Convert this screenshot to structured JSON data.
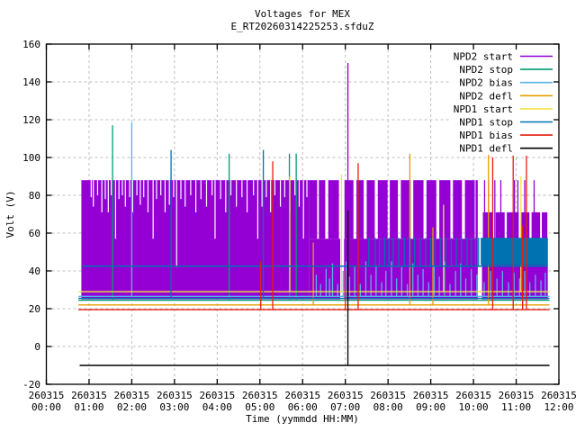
{
  "title": "Voltages for MEX",
  "subtitle": "E_RT20260314225253.sfduZ",
  "axes": {
    "x_label": "Time (yymmdd HH:MM)",
    "y_label": "Volt (V)",
    "x_range_hours": [
      0,
      12
    ],
    "y_range": [
      -20,
      160
    ],
    "x_tick_date": "260315",
    "x_tick_times": [
      "00:00",
      "01:00",
      "02:00",
      "03:00",
      "04:00",
      "05:00",
      "06:00",
      "07:00",
      "08:00",
      "09:00",
      "10:00",
      "11:00",
      "12:00"
    ],
    "y_ticks": [
      -20,
      0,
      20,
      40,
      60,
      80,
      100,
      120,
      140,
      160
    ],
    "grid": true,
    "grid_color": "#bebebe"
  },
  "legend": {
    "position": "top-right",
    "entries": [
      {
        "label": "NPD2 start",
        "color": "#9400D3"
      },
      {
        "label": "NPD2 stop",
        "color": "#009E73"
      },
      {
        "label": "NPD2 bias",
        "color": "#56B4E9"
      },
      {
        "label": "NPD2 defl",
        "color": "#E69F00"
      },
      {
        "label": "NPD1 start",
        "color": "#F0E442"
      },
      {
        "label": "NPD1 stop",
        "color": "#0072B2"
      },
      {
        "label": "NPD1 bias",
        "color": "#E51E10"
      },
      {
        "label": "NPD1 defl",
        "color": "#000000"
      }
    ]
  },
  "chart_data": {
    "type": "line",
    "x_unit": "hours after 260315 00:00",
    "y_unit": "V",
    "data_window_hours": [
      0.75,
      11.78
    ],
    "series": [
      {
        "name": "NPD2 start",
        "color": "#9400D3",
        "elements": [
          {
            "type": "block",
            "t0": 0.82,
            "t1": 6.15,
            "v0": 25,
            "v1": 88
          },
          {
            "type": "notches",
            "color": "#ffffff",
            "v1": 88,
            "items": [
              [
                1.05,
                79
              ],
              [
                1.1,
                74
              ],
              [
                1.2,
                80
              ],
              [
                1.3,
                71
              ],
              [
                1.38,
                78
              ],
              [
                1.45,
                71
              ],
              [
                1.52,
                80
              ],
              [
                1.62,
                57
              ],
              [
                1.7,
                78
              ],
              [
                1.78,
                80
              ],
              [
                1.85,
                74
              ],
              [
                1.95,
                79
              ],
              [
                2.02,
                71
              ],
              [
                2.12,
                80
              ],
              [
                2.2,
                75
              ],
              [
                2.28,
                79
              ],
              [
                2.38,
                71
              ],
              [
                2.5,
                57
              ],
              [
                2.58,
                78
              ],
              [
                2.68,
                80
              ],
              [
                2.78,
                71
              ],
              [
                2.88,
                75
              ],
              [
                2.98,
                79
              ],
              [
                3.05,
                42
              ],
              [
                3.15,
                78
              ],
              [
                3.25,
                74
              ],
              [
                3.38,
                80
              ],
              [
                3.5,
                71
              ],
              [
                3.62,
                78
              ],
              [
                3.75,
                74
              ],
              [
                3.88,
                80
              ],
              [
                3.95,
                57
              ],
              [
                4.08,
                78
              ],
              [
                4.2,
                71
              ],
              [
                4.32,
                80
              ],
              [
                4.45,
                74
              ],
              [
                4.58,
                79
              ],
              [
                4.7,
                71
              ],
              [
                4.85,
                80
              ],
              [
                4.95,
                57
              ],
              [
                5.05,
                74
              ],
              [
                5.15,
                79
              ],
              [
                5.25,
                71
              ],
              [
                5.35,
                80
              ],
              [
                5.48,
                74
              ],
              [
                5.58,
                79
              ],
              [
                5.7,
                71
              ],
              [
                5.82,
                80
              ],
              [
                5.92,
                74
              ],
              [
                6.02,
                57
              ],
              [
                6.1,
                79
              ]
            ]
          },
          {
            "type": "block",
            "t0": 6.15,
            "t1": 11.74,
            "v0": 25,
            "v1": 57
          },
          {
            "type": "columns",
            "v0": 57,
            "items": [
              [
                6.15,
                6.34,
                88
              ],
              [
                6.38,
                6.53,
                88
              ],
              [
                6.6,
                6.85,
                88
              ],
              [
                6.98,
                7.19,
                88
              ],
              [
                7.26,
                7.43,
                88
              ],
              [
                7.5,
                7.69,
                88
              ],
              [
                7.76,
                7.99,
                88
              ],
              [
                8.04,
                8.23,
                88
              ],
              [
                8.3,
                8.53,
                88
              ],
              [
                8.59,
                8.83,
                88
              ],
              [
                8.9,
                9.13,
                88
              ],
              [
                9.2,
                9.46,
                88
              ],
              [
                9.52,
                9.73,
                88
              ],
              [
                9.8,
                10.03,
                88
              ],
              [
                10.05,
                10.1,
                88
              ],
              [
                10.22,
                10.46,
                71
              ],
              [
                10.52,
                10.73,
                71
              ],
              [
                10.78,
                11.06,
                71
              ],
              [
                11.1,
                11.31,
                71
              ],
              [
                11.36,
                11.56,
                71
              ],
              [
                11.6,
                11.73,
                71
              ]
            ]
          },
          {
            "type": "vlines",
            "v0": 57,
            "v1": 88,
            "items": [
              10.26,
              10.35,
              10.5,
              10.64,
              10.96,
              11.04,
              11.2,
              11.42
            ]
          },
          {
            "type": "block",
            "color": "#ffffff",
            "t0": 6.88,
            "t1": 6.97,
            "v0": 25,
            "v1": 88
          },
          {
            "type": "block",
            "color": "#ffffff",
            "t0": 10.1,
            "t1": 10.2,
            "v0": 25,
            "v1": 57
          },
          {
            "type": "spikes",
            "v0": 25,
            "items": [
              [
                7.06,
                150
              ]
            ]
          }
        ]
      },
      {
        "name": "NPD2 stop",
        "color": "#009E73",
        "elements": [
          {
            "type": "hline",
            "v": 24.5,
            "t0": 0.75,
            "t1": 11.78
          },
          {
            "type": "spikes",
            "v0": 24.5,
            "items": [
              [
                1.55,
                117
              ],
              [
                4.28,
                102
              ],
              [
                5.69,
                102
              ],
              [
                5.85,
                102
              ]
            ]
          }
        ]
      },
      {
        "name": "NPD2 bias",
        "color": "#56B4E9",
        "elements": [
          {
            "type": "hline",
            "v": 26.5,
            "t0": 0.75,
            "t1": 11.78
          },
          {
            "type": "spikes",
            "v0": 26.5,
            "items": [
              [
                2.0,
                118.5
              ],
              [
                6.32,
                38
              ],
              [
                6.42,
                33
              ],
              [
                6.55,
                41
              ],
              [
                6.63,
                36
              ],
              [
                6.7,
                44
              ],
              [
                6.82,
                33
              ],
              [
                6.95,
                40
              ],
              [
                7.02,
                45
              ],
              [
                7.1,
                37
              ],
              [
                7.22,
                42
              ],
              [
                7.35,
                33
              ],
              [
                7.48,
                45
              ],
              [
                7.6,
                38
              ],
              [
                7.72,
                43
              ],
              [
                7.85,
                34
              ],
              [
                7.95,
                40
              ],
              [
                8.08,
                45
              ],
              [
                8.2,
                36
              ],
              [
                8.32,
                42
              ],
              [
                8.45,
                33
              ],
              [
                8.58,
                44
              ],
              [
                8.7,
                38
              ],
              [
                8.82,
                41
              ],
              [
                8.95,
                34
              ],
              [
                9.08,
                43
              ],
              [
                9.2,
                37
              ],
              [
                9.32,
                45
              ],
              [
                9.45,
                33
              ],
              [
                9.58,
                40
              ],
              [
                9.7,
                44
              ],
              [
                9.82,
                36
              ],
              [
                9.95,
                41
              ],
              [
                10.08,
                38
              ],
              [
                10.25,
                34
              ],
              [
                10.4,
                40
              ],
              [
                10.55,
                36
              ],
              [
                10.68,
                40
              ],
              [
                10.82,
                34
              ],
              [
                10.95,
                39
              ],
              [
                11.08,
                36
              ],
              [
                11.2,
                40
              ],
              [
                11.32,
                34
              ],
              [
                11.45,
                38
              ],
              [
                11.58,
                35
              ],
              [
                11.68,
                39
              ]
            ]
          }
        ]
      },
      {
        "name": "NPD2 defl",
        "color": "#E69F00",
        "elements": [
          {
            "type": "hline",
            "v": 22,
            "t0": 0.75,
            "t1": 11.78
          },
          {
            "type": "spikes",
            "v0": 22,
            "items": [
              [
                6.25,
                55
              ],
              [
                8.51,
                102
              ],
              [
                9.05,
                63
              ],
              [
                10.35,
                102
              ]
            ]
          }
        ]
      },
      {
        "name": "NPD1 start",
        "color": "#F0E442",
        "elements": [
          {
            "type": "hline",
            "v": 29,
            "t0": 0.75,
            "t1": 11.78
          },
          {
            "type": "spikes",
            "v0": 29,
            "items": [
              [
                5.7,
                90
              ],
              [
                6.91,
                91
              ],
              [
                9.3,
                75
              ],
              [
                11.11,
                90
              ]
            ]
          }
        ]
      },
      {
        "name": "NPD1 stop",
        "color": "#0072B2",
        "elements": [
          {
            "type": "hline",
            "v": 25.5,
            "t0": 0.75,
            "t1": 11.78
          },
          {
            "type": "hline",
            "v": 42.5,
            "t0": 0.82,
            "t1": 11.74
          },
          {
            "type": "vlines",
            "v0": 42,
            "v1": 57.5,
            "items": [
              7.55,
              7.7,
              7.8,
              7.92,
              8.02,
              8.12,
              8.25,
              8.38,
              8.5,
              8.62,
              8.75,
              8.88,
              9.0,
              9.1,
              9.22,
              9.35,
              9.48,
              9.6,
              9.72,
              9.85,
              9.95,
              10.05,
              10.12
            ]
          },
          {
            "type": "block",
            "t0": 10.17,
            "t1": 11.74,
            "v0": 43,
            "v1": 57.5
          },
          {
            "type": "spikes",
            "v0": 25.5,
            "items": [
              [
                2.92,
                104
              ],
              [
                5.08,
                104
              ]
            ]
          }
        ]
      },
      {
        "name": "NPD1 bias",
        "color": "#E51E10",
        "elements": [
          {
            "type": "hline",
            "v": 19.5,
            "t0": 0.75,
            "t1": 11.78
          },
          {
            "type": "spikes",
            "v0": 19.5,
            "items": [
              [
                5.02,
                45
              ],
              [
                5.3,
                98
              ],
              [
                7.0,
                40
              ],
              [
                7.3,
                97
              ],
              [
                10.45,
                100
              ],
              [
                10.93,
                101
              ],
              [
                11.15,
                64
              ],
              [
                11.24,
                101
              ]
            ]
          }
        ]
      },
      {
        "name": "NPD1 defl",
        "color": "#000000",
        "elements": [
          {
            "type": "hline",
            "v": -10,
            "t0": 0.78,
            "t1": 11.78
          },
          {
            "type": "spikes",
            "v0": -10,
            "items": [
              [
                7.06,
                72
              ]
            ]
          }
        ]
      }
    ]
  }
}
